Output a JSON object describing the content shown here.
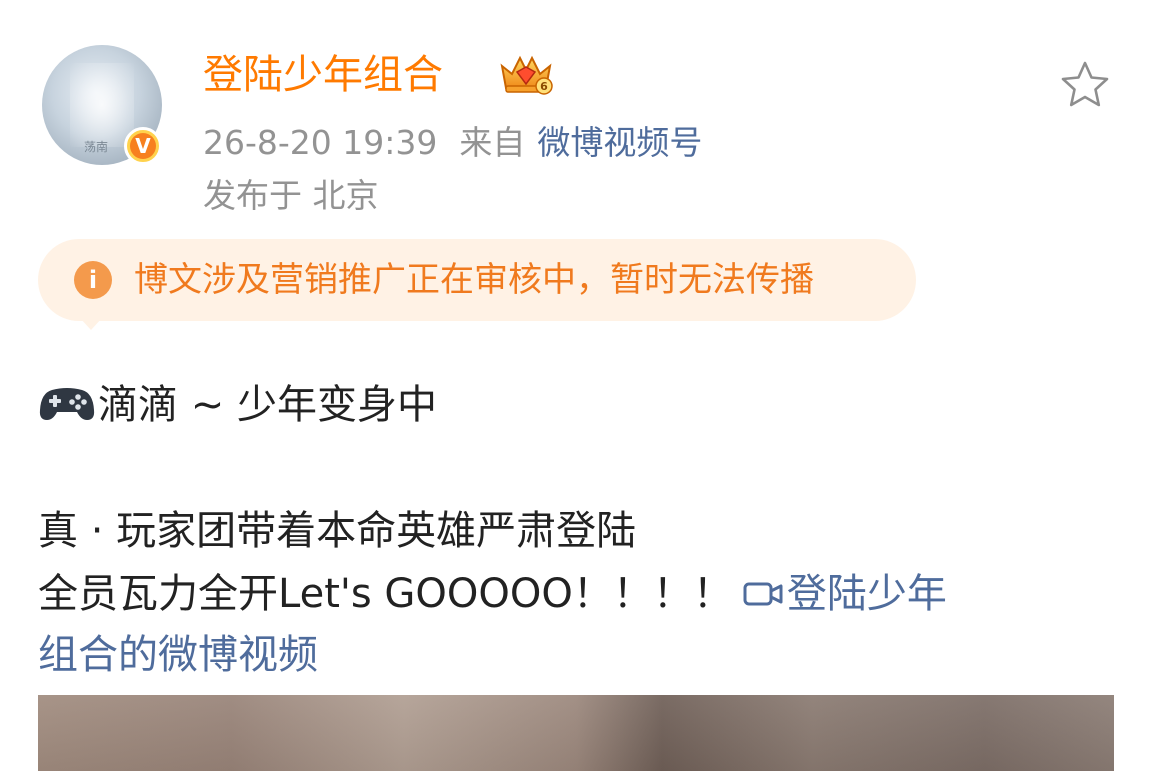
{
  "post": {
    "username": "登陆少年组合",
    "avatar_text": "荡南",
    "timestamp": "26-8-20 19:39",
    "from_label": "来自",
    "source": "微博视频号",
    "location": "发布于 北京",
    "icons": {
      "verified": "v-badge-icon",
      "crown": "crown-level-6-icon",
      "favorite": "star-icon",
      "notice": "info-icon",
      "emoji": "game-controller-icon",
      "video": "video-camera-icon"
    },
    "vip_level": "6",
    "notice": "博文涉及营销推广正在审核中，暂时无法传播",
    "lines": [
      "滴滴 ~ 少年变身中",
      "真 · 玩家团带着本命英雄严肃登陆",
      "全员瓦力全开Let's GOOOOO！！！！"
    ],
    "video_link_part1": "登陆少年",
    "video_link_part2": "组合的微博视频",
    "colors": {
      "username": "#ff7a00",
      "link": "#4f6c9c",
      "notice_bg": "#fff2e5",
      "notice_text": "#f07a1e",
      "meta": "#939393"
    }
  }
}
